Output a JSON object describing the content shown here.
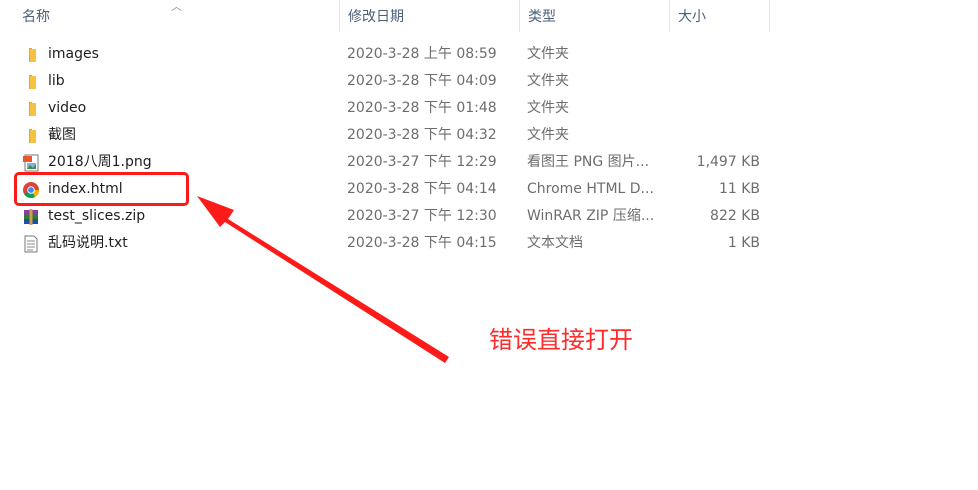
{
  "columns": {
    "name": "名称",
    "date": "修改日期",
    "type": "类型",
    "size": "大小"
  },
  "files": [
    {
      "name": "images",
      "date": "2020-3-28 上午 08:59",
      "type": "文件夹",
      "size": "",
      "icon": "folder-icon"
    },
    {
      "name": "lib",
      "date": "2020-3-28 下午 04:09",
      "type": "文件夹",
      "size": "",
      "icon": "folder-icon"
    },
    {
      "name": "video",
      "date": "2020-3-28 下午 01:48",
      "type": "文件夹",
      "size": "",
      "icon": "folder-icon"
    },
    {
      "name": "截图",
      "date": "2020-3-28 下午 04:32",
      "type": "文件夹",
      "size": "",
      "icon": "folder-icon"
    },
    {
      "name": "2018八周1.png",
      "date": "2020-3-27 下午 12:29",
      "type": "看图王 PNG 图片...",
      "size": "1,497 KB",
      "icon": "image-file-icon"
    },
    {
      "name": "index.html",
      "date": "2020-3-28 下午 04:14",
      "type": "Chrome HTML D...",
      "size": "11 KB",
      "icon": "chrome-icon"
    },
    {
      "name": "test_slices.zip",
      "date": "2020-3-27 下午 12:30",
      "type": "WinRAR ZIP 压缩...",
      "size": "822 KB",
      "icon": "winrar-icon"
    },
    {
      "name": "乱码说明.txt",
      "date": "2020-3-28 下午 04:15",
      "type": "文本文档",
      "size": "1 KB",
      "icon": "text-file-icon"
    }
  ],
  "annotation": {
    "text": "错误直接打开",
    "color": "#ff2a2a"
  },
  "colors": {
    "header_text": "#4c607a",
    "folder": "#f5c242",
    "highlight": "#ff1a1a"
  }
}
